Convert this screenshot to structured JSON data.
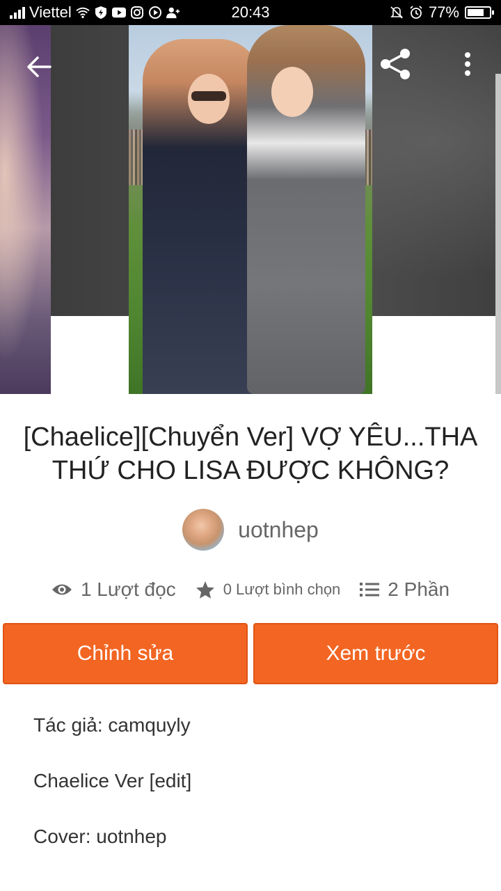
{
  "status_bar": {
    "carrier": "Viettel",
    "time": "20:43",
    "battery": "77%",
    "battery_fraction": 0.77,
    "icons": [
      "signal-icon",
      "wifi-icon",
      "shield-icon",
      "youtube-icon",
      "instagram-icon",
      "media-icon",
      "person-add-icon",
      "bell-off-icon",
      "alarm-icon",
      "battery-icon"
    ]
  },
  "toolbar": {
    "back_icon": "arrow-left-icon",
    "share_icon": "share-icon",
    "more_icon": "more-vertical-icon"
  },
  "story": {
    "title": "[Chaelice][Chuyển Ver] VỢ YÊU...THA THỨ CHO LISA ĐƯỢC KHÔNG?",
    "author": "uotnhep",
    "stats": {
      "reads": "1 Lượt đọc",
      "votes": "0 Lượt bình chọn",
      "parts": "2 Phần"
    }
  },
  "actions": {
    "edit": "Chỉnh sửa",
    "preview": "Xem trước"
  },
  "description": [
    "Tác giả: camquyly",
    "Chaelice Ver [edit]",
    "Cover: uotnhep"
  ],
  "colors": {
    "accent": "#f26522",
    "status_bar": "#000000",
    "text_muted": "#666666"
  }
}
